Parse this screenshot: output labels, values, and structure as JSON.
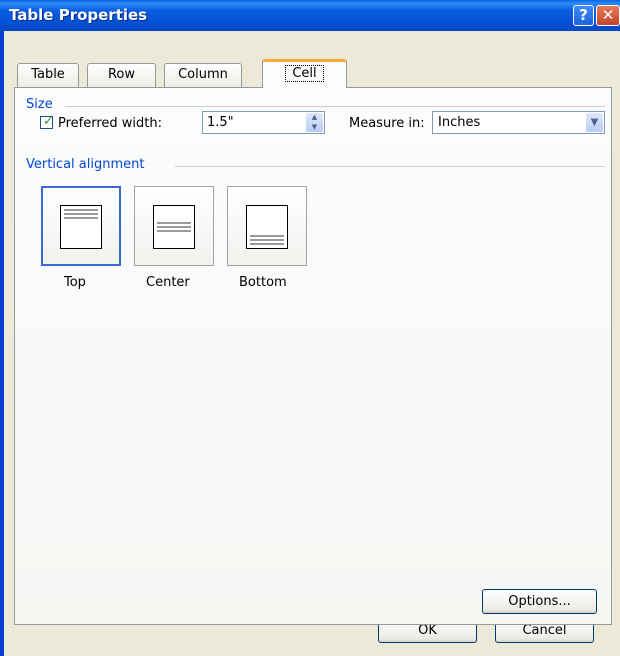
{
  "window": {
    "title": "Table Properties",
    "help_label": "?",
    "close_label": "✕"
  },
  "tabs": [
    {
      "label": "Table",
      "selected": false
    },
    {
      "label": "Row",
      "selected": false
    },
    {
      "label": "Column",
      "selected": false
    },
    {
      "label": "Cell",
      "selected": true
    }
  ],
  "size_group": {
    "label": "Size",
    "preferred_width_checked": true,
    "preferred_width_label": "Preferred width:",
    "preferred_width_value": "1.5\"",
    "measure_in_label": "Measure in:",
    "measure_in_value": "Inches"
  },
  "vertical_alignment": {
    "label": "Vertical alignment",
    "options": [
      {
        "label": "Top",
        "selected": true
      },
      {
        "label": "Center",
        "selected": false
      },
      {
        "label": "Bottom",
        "selected": false
      }
    ]
  },
  "buttons": {
    "options": "Options...",
    "ok": "OK",
    "cancel": "Cancel"
  },
  "colors": {
    "title_bar": "#0a5ce0",
    "group_label": "#0046d5",
    "selected_tab_accent": "#f6a830",
    "dialog_bg": "#ece9d8"
  }
}
